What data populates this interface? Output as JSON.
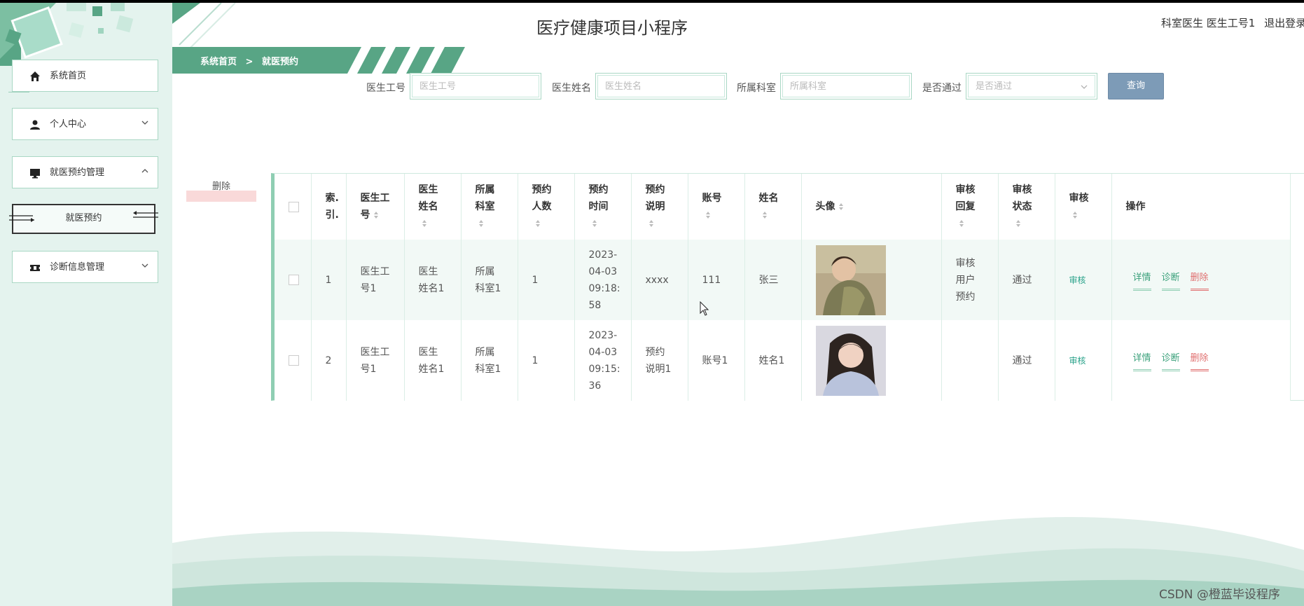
{
  "app": {
    "title": "医疗健康项目小程序"
  },
  "header": {
    "user_text": "科室医生 医生工号1",
    "logout": "退出登录"
  },
  "sidebar": {
    "items": [
      {
        "label": "系统首页",
        "icon": "home-icon"
      },
      {
        "label": "个人中心",
        "icon": "user-icon",
        "chevron": "chevron-down-icon"
      },
      {
        "label": "就医预约管理",
        "icon": "monitor-icon",
        "chevron": "chevron-up-icon"
      },
      {
        "label": "诊断信息管理",
        "icon": "ticket-icon",
        "chevron": "chevron-down-icon"
      }
    ],
    "subitems": [
      {
        "label": "就医预约"
      }
    ]
  },
  "breadcrumb": {
    "home": "系统首页",
    "separator": ">",
    "current": "就医预约"
  },
  "filters": {
    "doctor_no": {
      "label": "医生工号",
      "placeholder": "医生工号"
    },
    "doctor_name": {
      "label": "医生姓名",
      "placeholder": "医生姓名"
    },
    "department": {
      "label": "所属科室",
      "placeholder": "所属科室"
    },
    "passed": {
      "label": "是否通过",
      "placeholder": "是否通过"
    },
    "query_label": "查询"
  },
  "actions": {
    "delete_label": "删除"
  },
  "table": {
    "headers": {
      "index": "索.\n引.",
      "doctor_no": "医生工\n号",
      "doctor_name": "医生\n姓名",
      "department": "所属\n科室",
      "count": "预约\n人数",
      "time": "预约\n时间",
      "desc": "预约\n说明",
      "account": "账号",
      "name": "姓名",
      "avatar": "头像",
      "reply": "审核\n回复",
      "status": "审核\n状态",
      "audit": "审核",
      "ops": "操作"
    },
    "rows": [
      {
        "index": "1",
        "doctor_no": "医生工\n号1",
        "doctor_name": "医生\n姓名1",
        "department": "所属\n科室1",
        "count": "1",
        "time": "2023-\n04-03\n09:18:\n58",
        "desc": "xxxx",
        "account": "111",
        "name": "张三",
        "reply": "审核\n用户\n预约",
        "status": "通过",
        "audit": "审核",
        "op_detail": "详情",
        "op_diag": "诊断",
        "op_delete": "删除"
      },
      {
        "index": "2",
        "doctor_no": "医生工\n号1",
        "doctor_name": "医生\n姓名1",
        "department": "所属\n科室1",
        "count": "1",
        "time": "2023-\n04-03\n09:15:\n36",
        "desc": "预约\n说明1",
        "account": "账号1",
        "name": "姓名1",
        "reply": "",
        "status": "通过",
        "audit": "审核",
        "op_detail": "详情",
        "op_diag": "诊断",
        "op_delete": "删除"
      }
    ]
  },
  "watermark": "CSDN @橙蓝毕设程序",
  "colors": {
    "accent": "#58a585",
    "sidebar_bg": "#e4f3ee",
    "query_btn": "#7d9bb7",
    "delete_red": "#e07070"
  }
}
